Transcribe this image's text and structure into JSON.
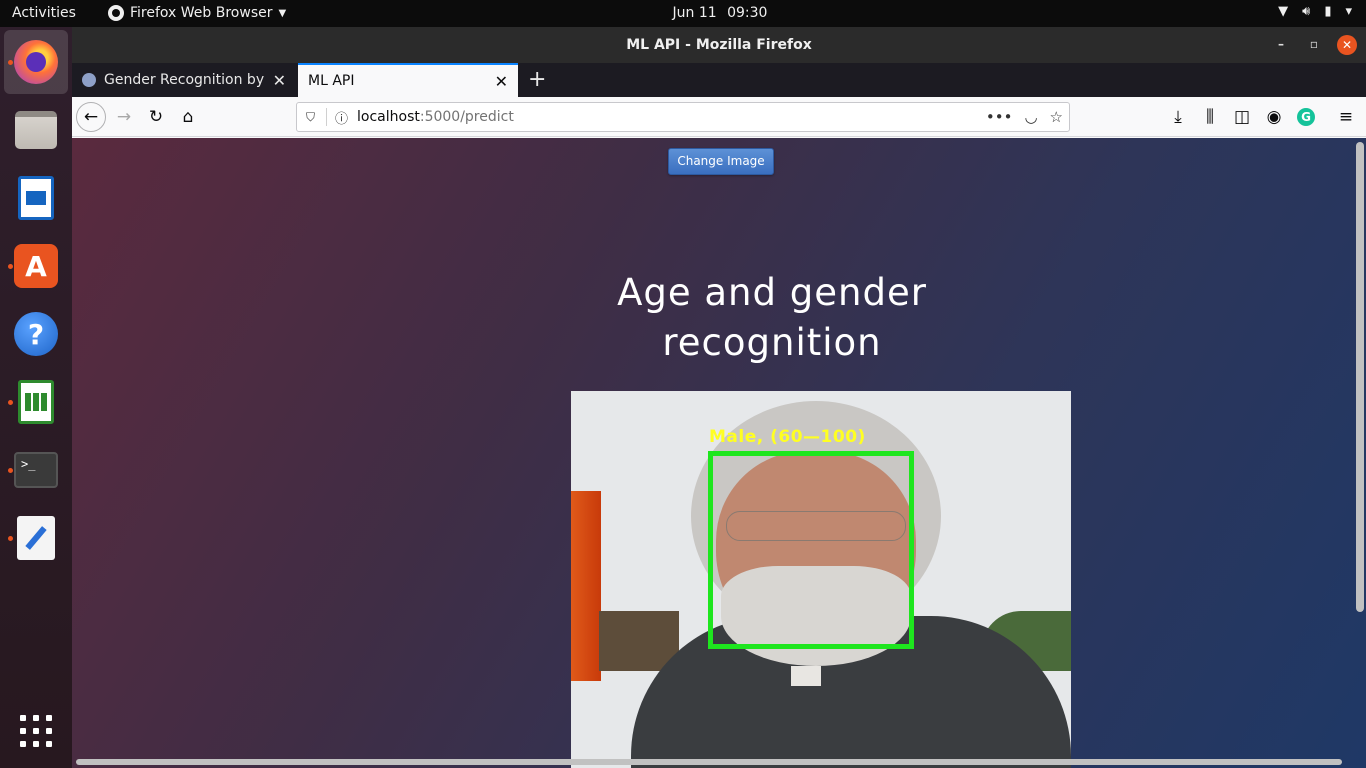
{
  "topbar": {
    "activities": "Activities",
    "app_name": "Firefox Web Browser",
    "date": "Jun 11",
    "time": "09:30"
  },
  "dock": {
    "items": [
      "firefox",
      "files",
      "libreoffice-writer",
      "ubuntu-software",
      "help",
      "libreoffice-calc",
      "terminal",
      "text-editor"
    ],
    "running_indicator_color": "#e95420"
  },
  "window": {
    "title": "ML API - Mozilla Firefox"
  },
  "tabs": [
    {
      "label": "Gender Recognition by V",
      "selected": false
    },
    {
      "label": "ML API",
      "selected": true
    }
  ],
  "urlbar": {
    "host": "localhost",
    "path": ":5000/predict"
  },
  "page": {
    "change_button": "Change Image",
    "heading_line1": "Age and gender",
    "heading_line2": "recognition",
    "prediction_label": "Male, (60—100)",
    "box_color": "#1ee61e",
    "label_color": "#ffff22"
  },
  "colors": {
    "accent": "#0a84ff",
    "ubuntu_orange": "#e95420",
    "button_blue": "#3a6fc0"
  }
}
